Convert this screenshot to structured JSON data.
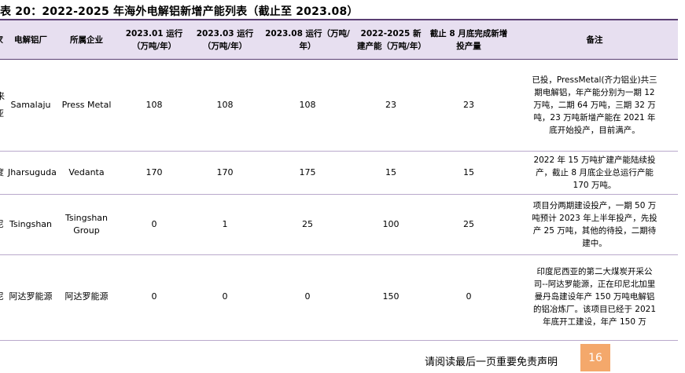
{
  "title": "表 20：2022-2025 年海外电解铝新增产能列表（截止至 2023.08）",
  "headers": {
    "country": "国家",
    "plant": "电解铝厂",
    "company": "所属企业",
    "jan": "2023.01 运行（万吨/年）",
    "mar": "2023.03 运行（万吨/年）",
    "aug": "2023.08 运行（万吨/年）",
    "new_cap": "2022-2025 新建产能（万吨/年）",
    "aug_done": "截止 8 月底完成新增投产量",
    "note": "备注"
  },
  "rows": [
    {
      "country": "马来西亚",
      "plant": "Samalaju",
      "company": "Press Metal",
      "jan": "108",
      "mar": "108",
      "aug": "108",
      "new_cap": "23",
      "aug_done": "23",
      "note": "已投，PressMetal(齐力铝业)共三期电解铝，年产能分别为一期 12 万吨，二期 64 万吨，三期 32 万吨，23 万吨新增产能在 2021 年底开始投产，目前满产。"
    },
    {
      "country": "印度",
      "plant": "Jharsuguda",
      "company": "Vedanta",
      "jan": "170",
      "mar": "170",
      "aug": "175",
      "new_cap": "15",
      "aug_done": "15",
      "note": "2022 年 15 万吨扩建产能陆续投产，截止 8 月底企业总运行产能 170 万吨。"
    },
    {
      "country": "印度尼西亚",
      "plant": "Tsingshan",
      "company": "Tsingshan Group",
      "jan": "0",
      "mar": "1",
      "aug": "25",
      "new_cap": "100",
      "aug_done": "25",
      "note": "项目分两期建设投产，一期 50 万吨预计 2023 年上半年投产，先投产 25 万吨，其他的待投，二期待建中。"
    },
    {
      "country": "印度尼西亚",
      "plant": "阿达罗能源",
      "company": "阿达罗能源",
      "jan": "0",
      "mar": "0",
      "aug": "0",
      "new_cap": "150",
      "aug_done": "0",
      "note": "印度尼西亚的第二大煤炭开采公司--阿达罗能源，正在印尼北加里曼丹岛建设年产 150 万吨电解铝的铝冶炼厂。该项目已经于 2021 年底开工建设，年产 150 万"
    }
  ],
  "footer": {
    "disclaimer": "请阅读最后一页重要免责声明",
    "page_number": "16"
  },
  "colors": {
    "header_bg": "#e7dff0",
    "rule": "#5a3e73",
    "page_box": "#f4a86b"
  }
}
